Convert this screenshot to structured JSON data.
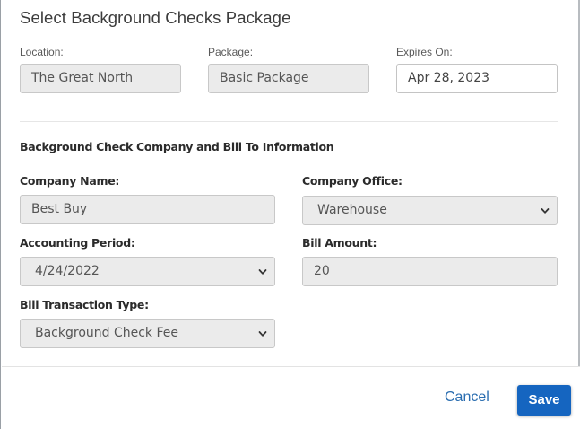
{
  "dialog": {
    "title": "Select Background Checks Package"
  },
  "top_row": {
    "location_label": "Location:",
    "location_value": "The Great North",
    "package_label": "Package:",
    "package_value": "Basic Package",
    "expires_label": "Expires On:",
    "expires_value": "Apr 28, 2023"
  },
  "section": {
    "heading": "Background Check Company and Bill To Information"
  },
  "form": {
    "company_name_label": "Company Name:",
    "company_name_value": "Best Buy",
    "company_office_label": "Company Office:",
    "company_office_value": "Warehouse",
    "accounting_period_label": "Accounting Period:",
    "accounting_period_value": "4/24/2022",
    "bill_amount_label": "Bill Amount:",
    "bill_amount_value": "20",
    "bill_transaction_type_label": "Bill Transaction Type:",
    "bill_transaction_type_value": "Background Check Fee"
  },
  "footer": {
    "cancel_label": "Cancel",
    "save_label": "Save"
  },
  "colors": {
    "primary": "#1565c0",
    "link": "#2a6db0",
    "disabled_field": "#ebebeb"
  }
}
